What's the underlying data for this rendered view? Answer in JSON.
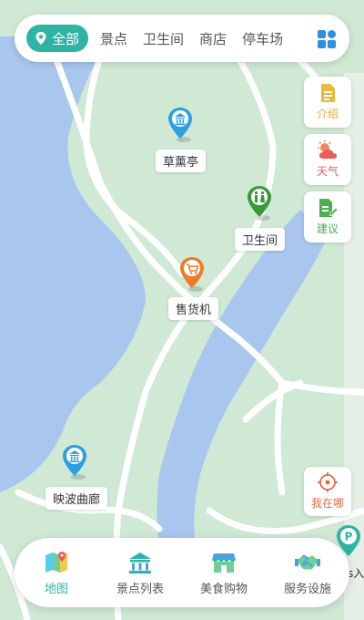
{
  "categories": {
    "active": "全部",
    "items": [
      "景点",
      "卫生间",
      "商店",
      "停车场"
    ]
  },
  "side_buttons": {
    "intro": "介绍",
    "weather": "天气",
    "suggest": "建议"
  },
  "pois": {
    "pavilion": "草薰亭",
    "toilet": "卫生间",
    "vending": "售货机",
    "corridor": "映波曲廊",
    "parking_partial": "s入"
  },
  "locate_label": "我在哪",
  "bottom_tabs": [
    "地图",
    "景点列表",
    "美食购物",
    "服务设施"
  ],
  "colors": {
    "accent": "#2fb3a5",
    "water": "#a9c6ef",
    "land": "#cfe9d5",
    "road": "#ffffff"
  }
}
